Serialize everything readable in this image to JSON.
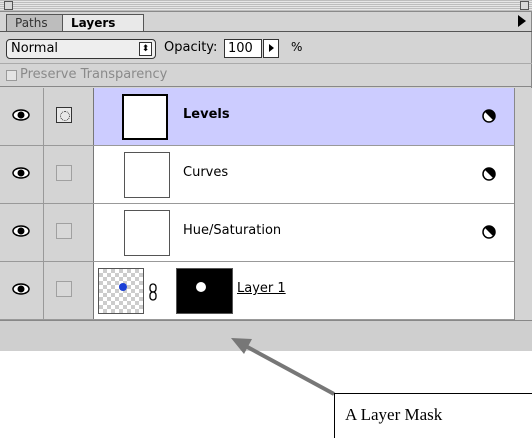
{
  "tabs": {
    "paths": "Paths",
    "layers": "Layers"
  },
  "blend_mode": {
    "value": "Normal",
    "stepper": "⬍"
  },
  "opacity": {
    "label": "Opacity:",
    "value": "100",
    "unit": "%"
  },
  "preserve_transparency": {
    "label": "Preserve Transparency",
    "checked": false
  },
  "layers": [
    {
      "name": "Levels",
      "selected": true,
      "type": "adjustment"
    },
    {
      "name": "Curves",
      "selected": false,
      "type": "adjustment"
    },
    {
      "name": "Hue/Saturation",
      "selected": false,
      "type": "adjustment"
    },
    {
      "name": "Layer 1",
      "selected": false,
      "type": "layer-with-mask"
    }
  ],
  "icons": {
    "eye": "eye-icon",
    "adjustment": "adjustment-layer-icon",
    "chain": "chain-link-icon",
    "panel_menu": "panel-menu-arrow-icon"
  },
  "annotation": {
    "text": "A Layer Mask"
  },
  "colors": {
    "selected_row": "#ccccff",
    "panel": "#d4d4d4",
    "layer_dot": "#1a3fd6"
  }
}
